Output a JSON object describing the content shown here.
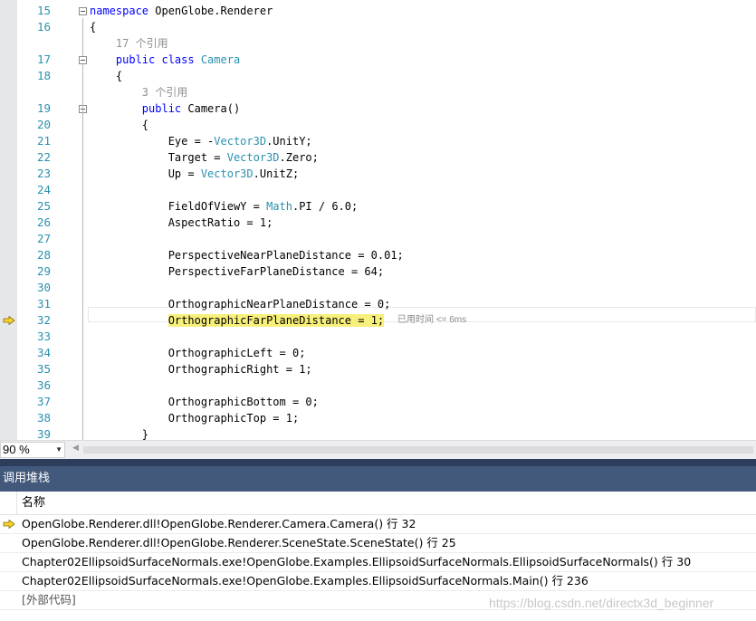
{
  "editor": {
    "lines": [
      {
        "n": "15",
        "segs": [
          {
            "t": "namespace ",
            "c": "kw"
          },
          {
            "t": "OpenGlobe.Renderer",
            "c": ""
          }
        ]
      },
      {
        "n": "16",
        "segs": [
          {
            "t": "{",
            "c": ""
          }
        ]
      },
      {
        "n": "",
        "segs": [
          {
            "t": "    17 个引用",
            "c": "cm"
          }
        ]
      },
      {
        "n": "17",
        "segs": [
          {
            "t": "    ",
            "c": ""
          },
          {
            "t": "public class ",
            "c": "kw"
          },
          {
            "t": "Camera",
            "c": "ty"
          }
        ]
      },
      {
        "n": "18",
        "segs": [
          {
            "t": "    {",
            "c": ""
          }
        ]
      },
      {
        "n": "",
        "segs": [
          {
            "t": "        3 个引用",
            "c": "cm"
          }
        ]
      },
      {
        "n": "19",
        "segs": [
          {
            "t": "        ",
            "c": ""
          },
          {
            "t": "public ",
            "c": "kw"
          },
          {
            "t": "Camera()",
            "c": ""
          }
        ]
      },
      {
        "n": "20",
        "segs": [
          {
            "t": "        {",
            "c": ""
          }
        ]
      },
      {
        "n": "21",
        "segs": [
          {
            "t": "            Eye = -",
            "c": ""
          },
          {
            "t": "Vector3D",
            "c": "ty"
          },
          {
            "t": ".UnitY;",
            "c": ""
          }
        ]
      },
      {
        "n": "22",
        "segs": [
          {
            "t": "            Target = ",
            "c": ""
          },
          {
            "t": "Vector3D",
            "c": "ty"
          },
          {
            "t": ".Zero;",
            "c": ""
          }
        ]
      },
      {
        "n": "23",
        "segs": [
          {
            "t": "            Up = ",
            "c": ""
          },
          {
            "t": "Vector3D",
            "c": "ty"
          },
          {
            "t": ".UnitZ;",
            "c": ""
          }
        ]
      },
      {
        "n": "24",
        "segs": []
      },
      {
        "n": "25",
        "segs": [
          {
            "t": "            FieldOfViewY = ",
            "c": ""
          },
          {
            "t": "Math",
            "c": "ty"
          },
          {
            "t": ".PI / 6.0;",
            "c": ""
          }
        ]
      },
      {
        "n": "26",
        "segs": [
          {
            "t": "            AspectRatio = 1;",
            "c": ""
          }
        ]
      },
      {
        "n": "27",
        "segs": []
      },
      {
        "n": "28",
        "segs": [
          {
            "t": "            PerspectiveNearPlaneDistance = 0.01;",
            "c": ""
          }
        ]
      },
      {
        "n": "29",
        "segs": [
          {
            "t": "            PerspectiveFarPlaneDistance = 64;",
            "c": ""
          }
        ]
      },
      {
        "n": "30",
        "segs": []
      },
      {
        "n": "31",
        "segs": [
          {
            "t": "            OrthographicNearPlaneDistance = 0;",
            "c": ""
          }
        ]
      },
      {
        "n": "32",
        "segs": [
          {
            "t": "            ",
            "c": ""
          },
          {
            "t": "OrthographicFarPlaneDistance = 1;",
            "c": "hl"
          }
        ],
        "current": true,
        "elapsed": "已用时间 <= 6ms"
      },
      {
        "n": "33",
        "segs": []
      },
      {
        "n": "34",
        "segs": [
          {
            "t": "            OrthographicLeft = 0;",
            "c": ""
          }
        ]
      },
      {
        "n": "35",
        "segs": [
          {
            "t": "            OrthographicRight = 1;",
            "c": ""
          }
        ]
      },
      {
        "n": "36",
        "segs": []
      },
      {
        "n": "37",
        "segs": [
          {
            "t": "            OrthographicBottom = 0;",
            "c": ""
          }
        ]
      },
      {
        "n": "38",
        "segs": [
          {
            "t": "            OrthographicTop = 1;",
            "c": ""
          }
        ]
      },
      {
        "n": "39",
        "segs": [
          {
            "t": "        }",
            "c": ""
          }
        ]
      }
    ],
    "zoom": "90 %"
  },
  "callstack": {
    "title": "调用堆栈",
    "column_name": "名称",
    "rows": [
      {
        "text": "OpenGlobe.Renderer.dll!OpenGlobe.Renderer.Camera.Camera() 行 32",
        "current": true
      },
      {
        "text": "OpenGlobe.Renderer.dll!OpenGlobe.Renderer.SceneState.SceneState() 行 25",
        "current": false
      },
      {
        "text": "Chapter02EllipsoidSurfaceNormals.exe!OpenGlobe.Examples.EllipsoidSurfaceNormals.EllipsoidSurfaceNormals() 行 30",
        "current": false
      },
      {
        "text": "Chapter02EllipsoidSurfaceNormals.exe!OpenGlobe.Examples.EllipsoidSurfaceNormals.Main() 行 236",
        "current": false
      },
      {
        "text": "[外部代码]",
        "current": false,
        "external": true
      }
    ]
  },
  "watermark": "https://blog.csdn.net/directx3d_beginner",
  "colors": {
    "keyword": "#0000ff",
    "type": "#2b91af",
    "highlight": "#f7f07a",
    "panel_header": "#42597b",
    "arrow": "#f5d32c"
  },
  "icons": {
    "fold": "collapse-box-icon",
    "current": "instruction-pointer-arrow-icon",
    "dropdown": "chevron-down-icon"
  }
}
